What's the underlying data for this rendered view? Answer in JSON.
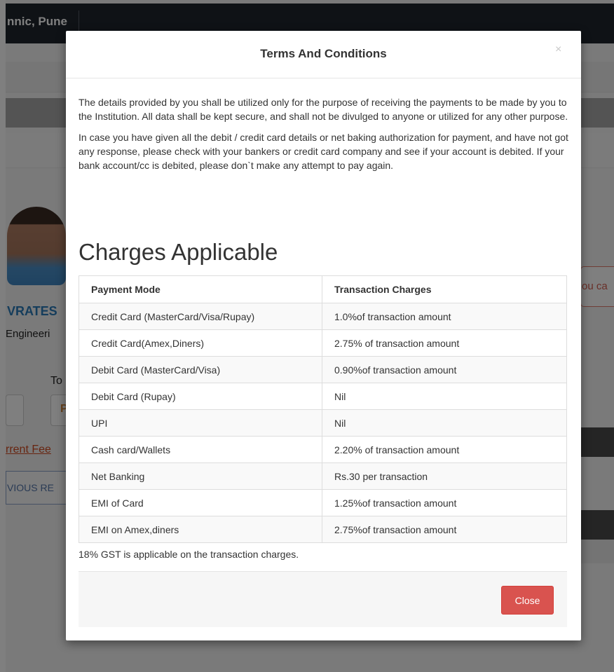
{
  "page": {
    "header_title": "nnic, Pune",
    "student_name": "VRATES",
    "student_branch": "Engineeri",
    "to_label": "To",
    "input_fragment": "P",
    "fee_link": "rrent Fee",
    "prev_tab": "VIOUS RE",
    "right_text": "ou ca"
  },
  "modal": {
    "title": "Terms And Conditions",
    "close_icon": "×",
    "paragraphs": [
      "The details provided by you shall be utilized only for the purpose of receiving the payments to be made by you to the Institution. All data shall be kept secure, and shall not be divulged to anyone or utilized for any other purpose.",
      "In case you have given all the debit / credit card details or net baking authorization for payment, and have not got any response, please check with your bankers or credit card company and see if your account is debited. If your bank account/cc is debited, please don`t make any attempt to pay again."
    ],
    "charges_heading": "Charges Applicable",
    "table": {
      "headers": [
        "Payment Mode",
        "Transaction Charges"
      ],
      "rows": [
        [
          "Credit Card (MasterCard/Visa/Rupay)",
          "1.0%of transaction amount"
        ],
        [
          "Credit Card(Amex,Diners)",
          "2.75% of transaction amount"
        ],
        [
          "Debit Card (MasterCard/Visa)",
          "0.90%of transaction amount"
        ],
        [
          "Debit Card (Rupay)",
          "Nil"
        ],
        [
          "UPI",
          "Nil"
        ],
        [
          "Cash card/Wallets",
          "2.20% of transaction amount"
        ],
        [
          "Net Banking",
          "Rs.30 per transaction"
        ],
        [
          "EMI of Card",
          "1.25%of transaction amount"
        ],
        [
          "EMI on Amex,diners",
          "2.75%of transaction amount"
        ]
      ]
    },
    "gst_note": "18% GST is applicable on the transaction charges.",
    "close_button": "Close"
  },
  "colors": {
    "close_button": "#d9534f",
    "topbar": "#1f242d",
    "link": "#d04b21",
    "name": "#2a7ab8"
  }
}
